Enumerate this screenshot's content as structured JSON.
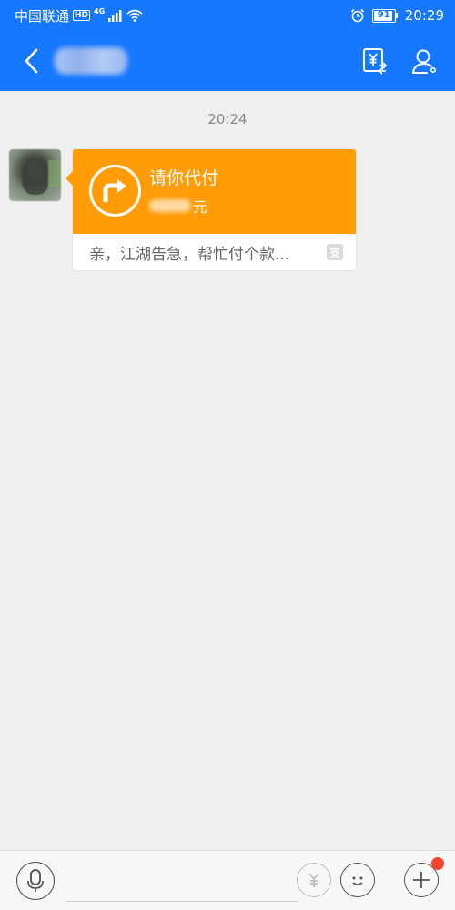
{
  "status_bar": {
    "carrier": "中国联通",
    "hd": "HD",
    "network": "4G",
    "battery": "91",
    "battery_level": 0.91,
    "time": "20:29",
    "icons": [
      "signal-icon",
      "wifi-icon",
      "alarm-icon",
      "battery-icon"
    ]
  },
  "nav": {
    "icons": [
      "back-icon",
      "bill-icon",
      "profile-icon"
    ]
  },
  "chat": {
    "timestamp": "20:24",
    "message": {
      "title": "请你代付",
      "amount_unit": "元",
      "description": "亲，江湖告急，帮忙付个款..."
    }
  },
  "bottom_bar": {
    "icons": [
      "microphone-icon",
      "yuan-icon",
      "emoji-icon",
      "plus-icon"
    ]
  },
  "colors": {
    "primary": "#1677ff",
    "card": "#ff9c08",
    "badge": "#f5432c"
  }
}
